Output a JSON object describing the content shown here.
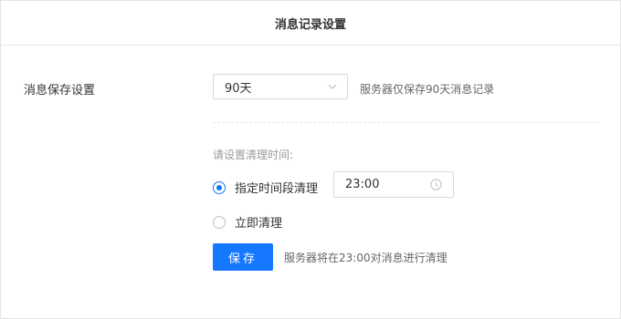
{
  "header": {
    "title": "消息记录设置"
  },
  "retention": {
    "label": "消息保存设置",
    "selected": "90天",
    "hint": "服务器仅保存90天消息记录"
  },
  "cleanup": {
    "prompt": "请设置清理时间:",
    "options": [
      {
        "label": "指定时间段清理",
        "checked": true
      },
      {
        "label": "立即清理",
        "checked": false
      }
    ],
    "time_value": "23:00"
  },
  "actions": {
    "save_label": "保存",
    "save_note": "服务器将在23:00对消息进行清理"
  },
  "colors": {
    "accent": "#1677ff"
  },
  "icons": {
    "select": "chevron-down-icon",
    "time": "clock-icon"
  }
}
